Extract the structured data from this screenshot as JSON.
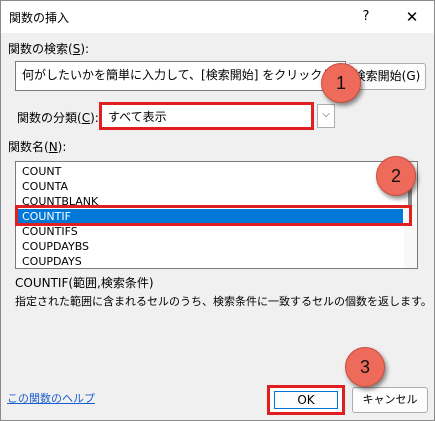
{
  "window": {
    "title": "関数の挿入",
    "help_glyph": "?",
    "close_glyph": "✕"
  },
  "search": {
    "label_prefix": "関数の検索(",
    "label_key": "S",
    "label_suffix": "):",
    "value": "何がしたいかを簡単に入力して、[検索開始] をクリックしてください。",
    "button_label": "検索開始(G)"
  },
  "category": {
    "label_prefix": "関数の分類(",
    "label_key": "C",
    "label_suffix": "):",
    "selected": "すべて表示",
    "chevron_glyph": "⌵"
  },
  "functions": {
    "label_prefix": "関数名(",
    "label_key": "N",
    "label_suffix": "):",
    "items": [
      {
        "label": "COUNT",
        "selected": false
      },
      {
        "label": "COUNTA",
        "selected": false
      },
      {
        "label": "COUNTBLANK",
        "selected": false
      },
      {
        "label": "COUNTIF",
        "selected": true
      },
      {
        "label": "COUNTIFS",
        "selected": false
      },
      {
        "label": "COUPDAYBS",
        "selected": false
      },
      {
        "label": "COUPDAYS",
        "selected": false
      }
    ]
  },
  "description": {
    "syntax": "COUNTIF(範囲,検索条件)",
    "text": "指定された範囲に含まれるセルのうち、検索条件に一致するセルの個数を返します。"
  },
  "footer": {
    "help_link": "この関数のヘルプ",
    "ok_label": "OK",
    "cancel_label": "キャンセル"
  },
  "callouts": {
    "step1": "1",
    "step2": "2",
    "step3": "3"
  },
  "colors": {
    "highlight": "#e02020",
    "selection": "#0078d7",
    "badge": "#ee6b5b",
    "link": "#1a5fd0"
  }
}
